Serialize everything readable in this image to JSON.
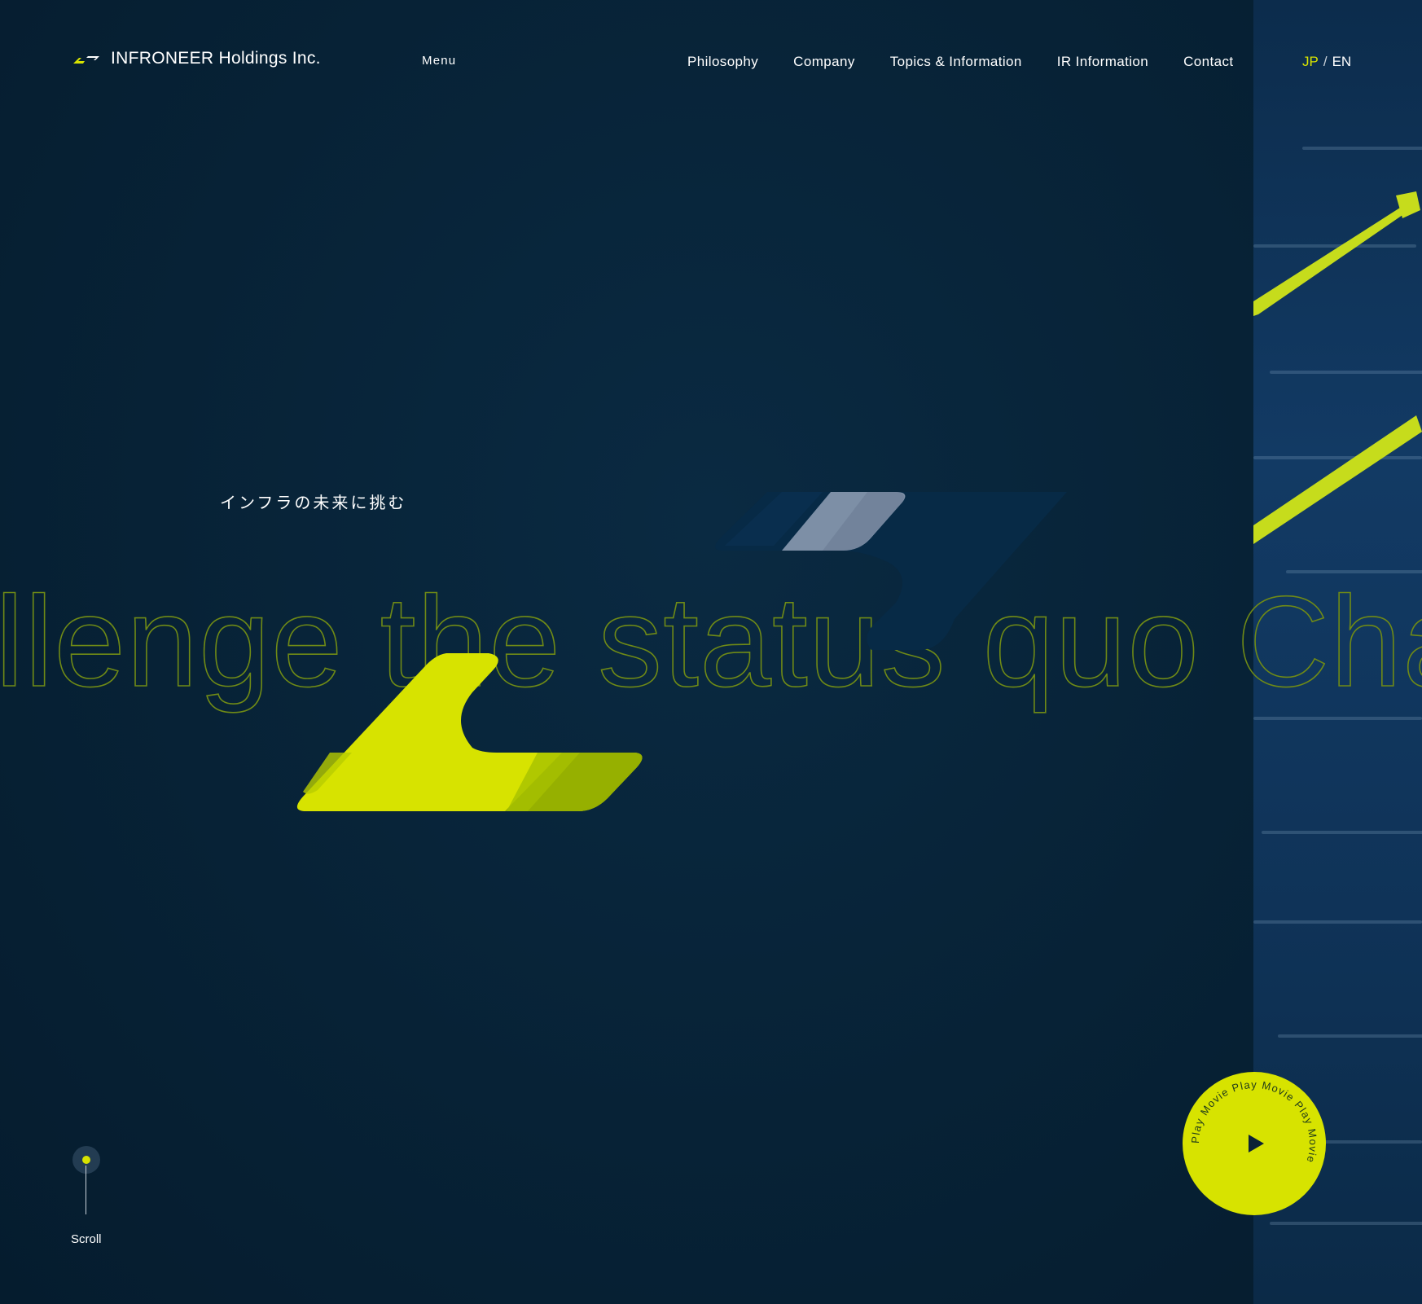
{
  "header": {
    "logo_text": "INFRONEER Holdings Inc.",
    "menu_label": "Menu",
    "nav": [
      {
        "label": "Philosophy"
      },
      {
        "label": "Company"
      },
      {
        "label": "Topics & Information"
      },
      {
        "label": "IR Information"
      },
      {
        "label": "Contact"
      }
    ],
    "lang": {
      "active": "JP",
      "separator": "/",
      "other": "EN"
    }
  },
  "hero": {
    "tagline": "インフラの未来に挑む",
    "marquee_text": "llenge the status quo Challe"
  },
  "scroll": {
    "label": "Scroll"
  },
  "play_button": {
    "ring_text": "Play Movie Play Movie Play Movie ",
    "icon": "play-icon"
  },
  "colors": {
    "background": "#072236",
    "accent": "#d7e300",
    "accent_dark": "#96b000",
    "navy_shape": "#0b2c4a",
    "grey_shape": "#7d8fa6"
  }
}
